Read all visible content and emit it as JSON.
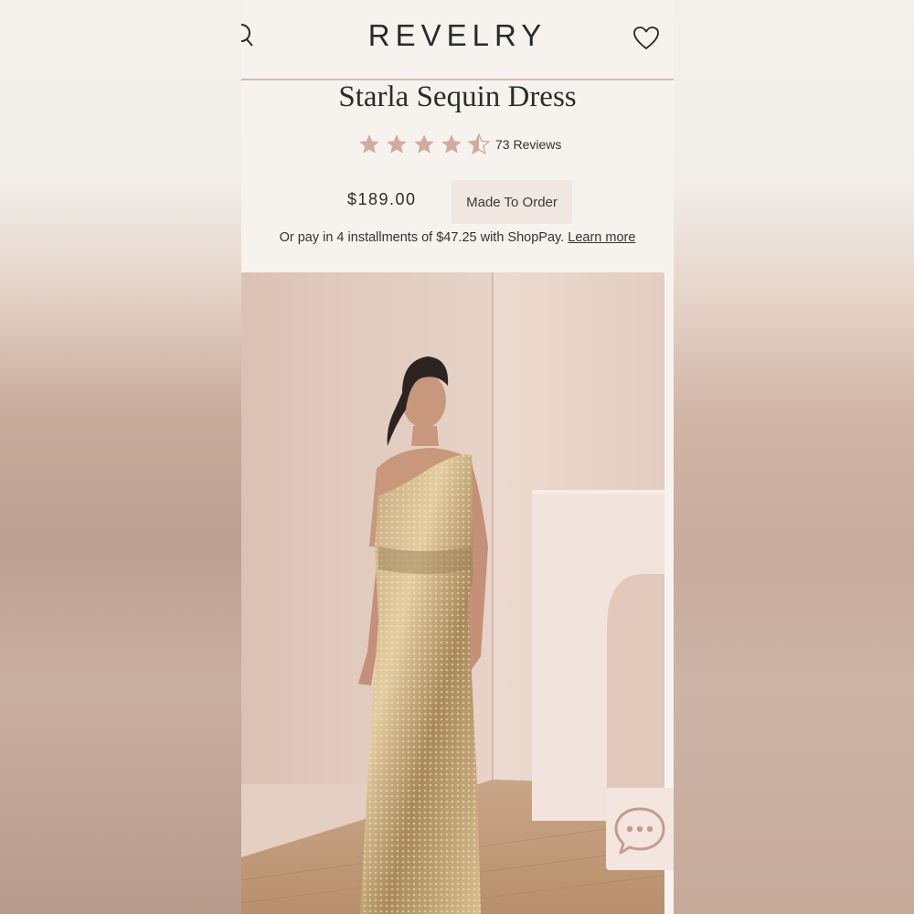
{
  "header": {
    "logo": "REVELRY",
    "search_icon": "search-icon",
    "wishlist_icon": "heart-icon"
  },
  "product": {
    "title": "Starla Sequin Dress",
    "rating_stars": 4.5,
    "rating_max": 5,
    "reviews_label": "73 Reviews",
    "price": "$189.00",
    "availability": "Made To Order",
    "installments_text": "Or pay in 4 installments of $47.25 with ShopPay.",
    "installments_link": "Learn more"
  },
  "image": {
    "description_icon": "product-photo"
  },
  "chat": {
    "icon": "chat-bubble-icon"
  },
  "colors": {
    "star": "#d2aba0",
    "divider": "#d9b9ab",
    "background": "#f6f3ee"
  }
}
